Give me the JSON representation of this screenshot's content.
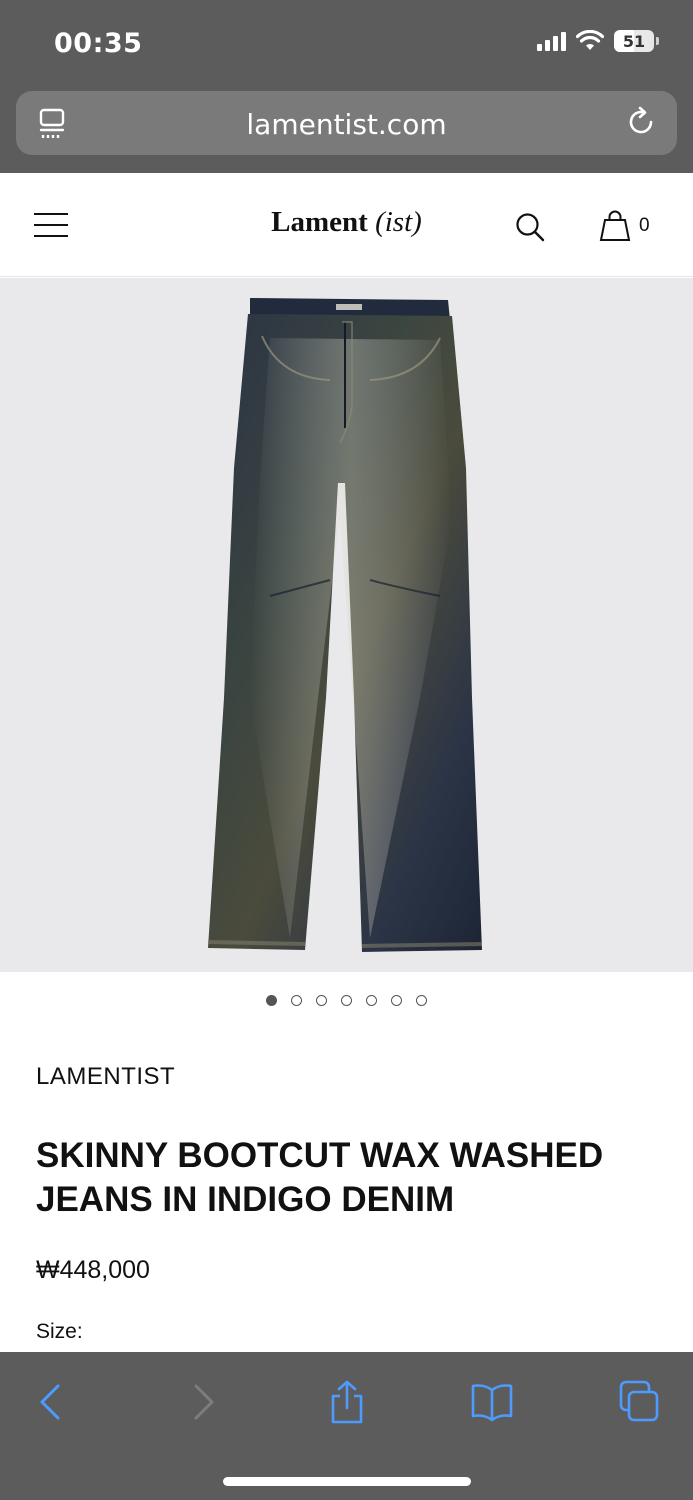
{
  "status": {
    "time": "00:35",
    "battery": "51",
    "battery_level": 0.51
  },
  "browser": {
    "url": "lamentist.com"
  },
  "header": {
    "logo_main": "Lament",
    "logo_italic": "(ist)",
    "cart_count": "0"
  },
  "gallery": {
    "image_count": 7,
    "active_index": 0
  },
  "product": {
    "brand": "LAMENTIST",
    "title": "SKINNY BOOTCUT WAX WASHED JEANS IN INDIGO DENIM",
    "price": "₩448,000",
    "size_label": "Size:"
  },
  "icons": {
    "url_left": "reader-mode-icon",
    "url_right": "reload-icon",
    "toolbar": [
      "back-icon",
      "forward-icon",
      "share-icon",
      "bookmarks-icon",
      "tabs-icon"
    ]
  },
  "colors": {
    "chrome": "#5c5c5c",
    "toolbar_accent": "#4e9bff",
    "image_bg": "#e9e9eb"
  }
}
